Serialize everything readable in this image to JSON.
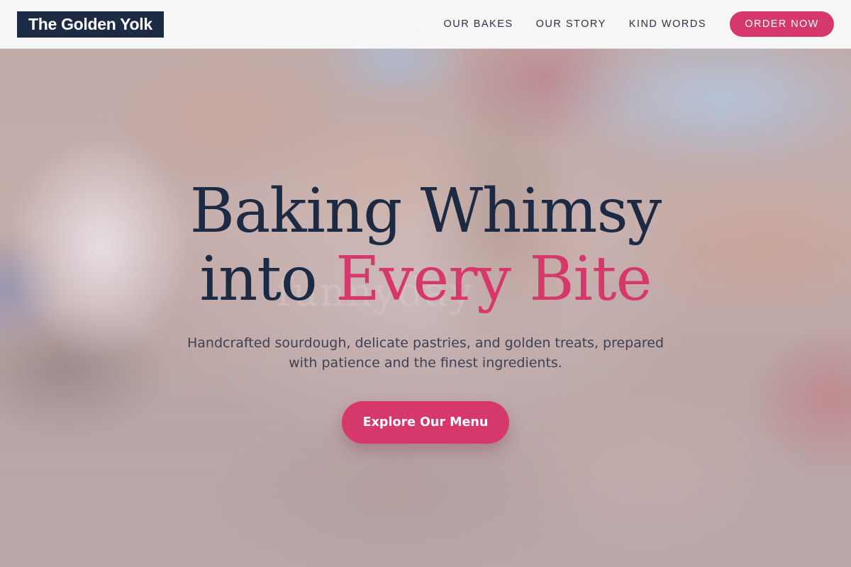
{
  "brand": {
    "name": "The Golden Yolk"
  },
  "nav": {
    "items": [
      {
        "label": "OUR BAKES"
      },
      {
        "label": "OUR STORY"
      },
      {
        "label": "KIND WORDS"
      }
    ],
    "order_label": "ORDER NOW"
  },
  "hero": {
    "title_line1": "Baking Whimsy",
    "title_line2_plain": "into",
    "title_line2_accent": "Every Bite",
    "ghost_text": "funnyday",
    "subtitle": "Handcrafted sourdough, delicate pastries, and golden treats, prepared with patience and the finest ingredients.",
    "cta_label": "Explore Our Menu"
  },
  "colors": {
    "navy": "#1d2a44",
    "accent_pink": "#d6386b",
    "header_bg": "#fafafb",
    "text_muted": "#3f4152"
  }
}
